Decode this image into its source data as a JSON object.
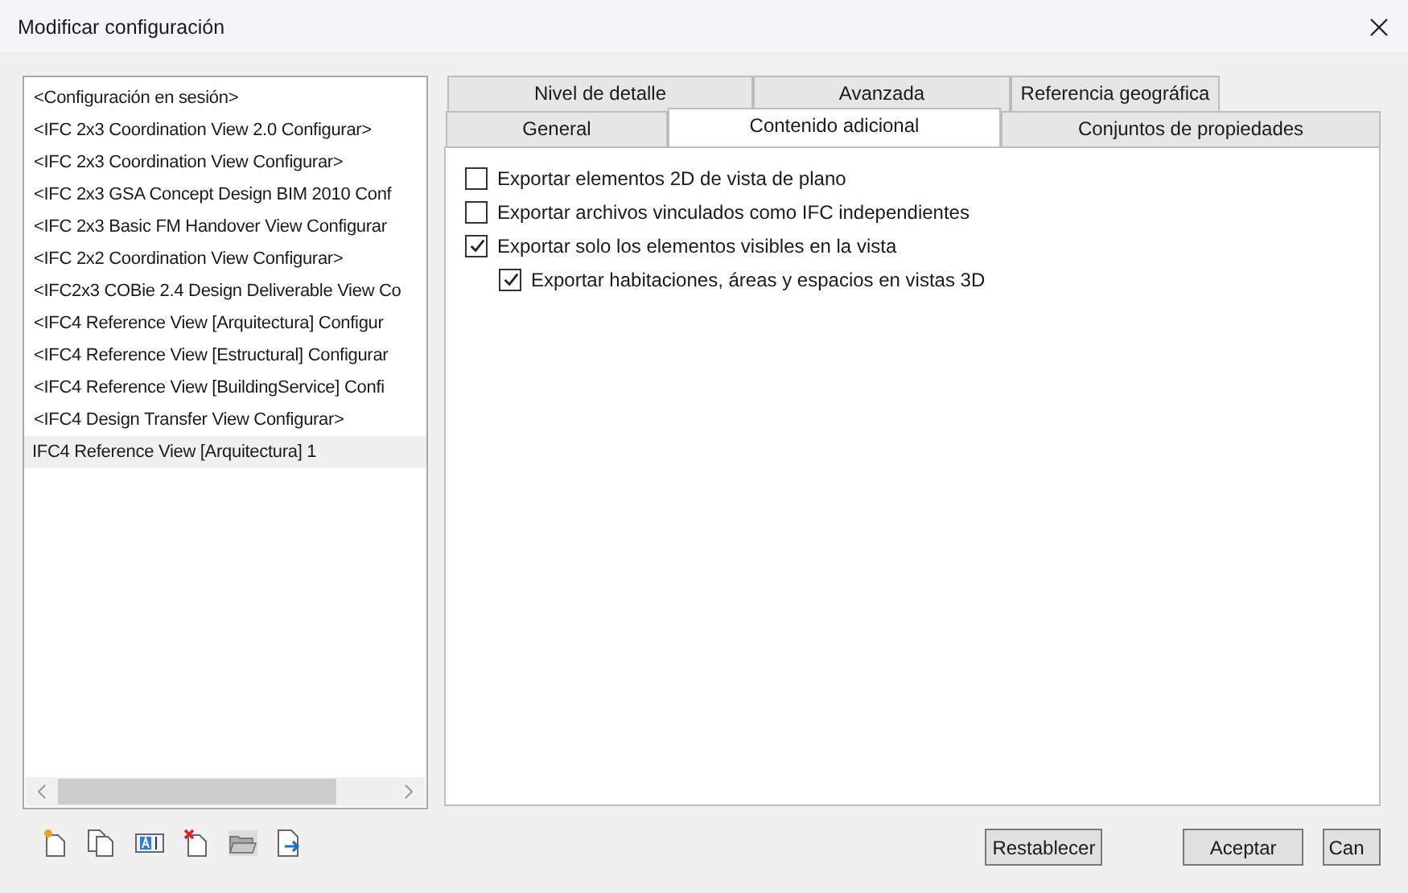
{
  "window": {
    "title": "Modificar configuración"
  },
  "configurations": [
    {
      "label": "<Configuración en sesión>",
      "selected": false
    },
    {
      "label": "<IFC 2x3 Coordination View 2.0 Configurar>",
      "selected": false
    },
    {
      "label": "<IFC 2x3 Coordination View Configurar>",
      "selected": false
    },
    {
      "label": "<IFC 2x3 GSA Concept Design BIM 2010 Conf",
      "selected": false
    },
    {
      "label": "<IFC 2x3 Basic FM Handover View Configurar",
      "selected": false
    },
    {
      "label": "<IFC 2x2 Coordination View Configurar>",
      "selected": false
    },
    {
      "label": "<IFC2x3 COBie 2.4 Design Deliverable View Co",
      "selected": false
    },
    {
      "label": "<IFC4 Reference View [Arquitectura] Configur",
      "selected": false
    },
    {
      "label": "<IFC4 Reference View [Estructural] Configurar",
      "selected": false
    },
    {
      "label": "<IFC4 Reference View [BuildingService] Confi",
      "selected": false
    },
    {
      "label": "<IFC4 Design Transfer View Configurar>",
      "selected": false
    },
    {
      "label": "IFC4 Reference View [Arquitectura] 1",
      "selected": true
    }
  ],
  "tab_rows": [
    [
      {
        "label": "Nivel de detalle",
        "selected": false
      },
      {
        "label": "Avanzada",
        "selected": false
      },
      {
        "label": "Referencia geográfica",
        "selected": false
      }
    ],
    [
      {
        "label": "General",
        "selected": false
      },
      {
        "label": "Contenido adicional",
        "selected": true
      },
      {
        "label": "Conjuntos de propiedades",
        "selected": false
      }
    ]
  ],
  "options": [
    {
      "label": "Exportar elementos 2D de vista de plano",
      "checked": false
    },
    {
      "label": "Exportar archivos vinculados como IFC independientes",
      "checked": false
    },
    {
      "label": "Exportar solo los elementos visibles en la vista",
      "checked": true,
      "children": [
        {
          "label": "Exportar habitaciones, áreas y espacios en vistas 3D",
          "checked": true
        }
      ]
    }
  ],
  "buttons": [
    {
      "label": "Restablecer",
      "kind": "reset"
    },
    {
      "label": "Aceptar",
      "kind": "ok"
    },
    {
      "label": "Can",
      "kind": "cancel"
    }
  ]
}
